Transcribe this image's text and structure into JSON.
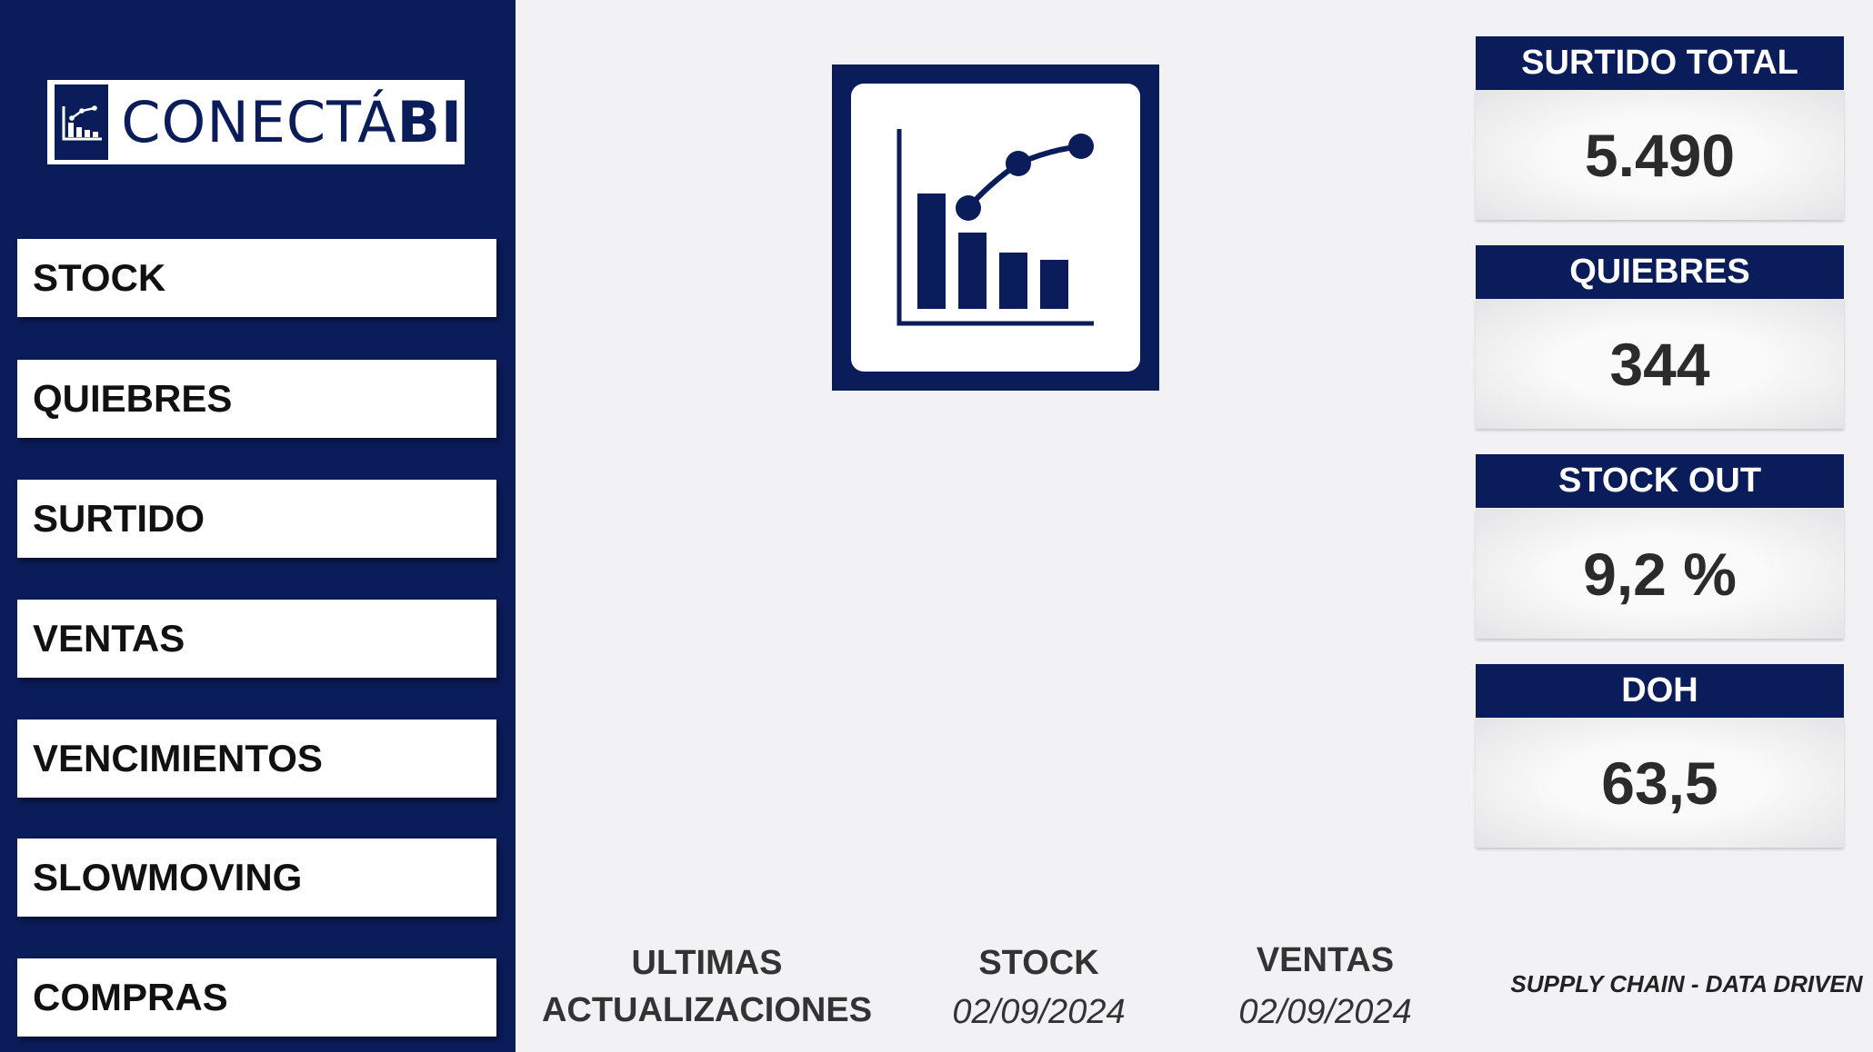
{
  "brand": {
    "name_light": "CONECTÁ",
    "name_bold": "BI",
    "logo_icon": "bar-chart-icon"
  },
  "nav": [
    {
      "label": "STOCK"
    },
    {
      "label": "QUIEBRES"
    },
    {
      "label": "SURTIDO"
    },
    {
      "label": "VENTAS"
    },
    {
      "label": "VENCIMIENTOS"
    },
    {
      "label": "SLOWMOVING"
    },
    {
      "label": "COMPRAS"
    }
  ],
  "hero_icon": "bar-line-chart-icon",
  "kpis": [
    {
      "title": "SURTIDO TOTAL",
      "value": "5.490"
    },
    {
      "title": "QUIEBRES",
      "value": "344"
    },
    {
      "title": "STOCK OUT",
      "value": "9,2 %"
    },
    {
      "title": "DOH",
      "value": "63,5"
    }
  ],
  "updates": {
    "title_line1": "ULTIMAS",
    "title_line2": "ACTUALIZACIONES",
    "stock_label": "STOCK",
    "stock_date": "02/09/2024",
    "ventas_label": "VENTAS",
    "ventas_date": "02/09/2024"
  },
  "tagline": "SUPPLY CHAIN - DATA DRIVEN",
  "colors": {
    "brand_navy": "#0b1c5a",
    "background": "#f2f2f4",
    "button_bg": "#ffffff"
  }
}
